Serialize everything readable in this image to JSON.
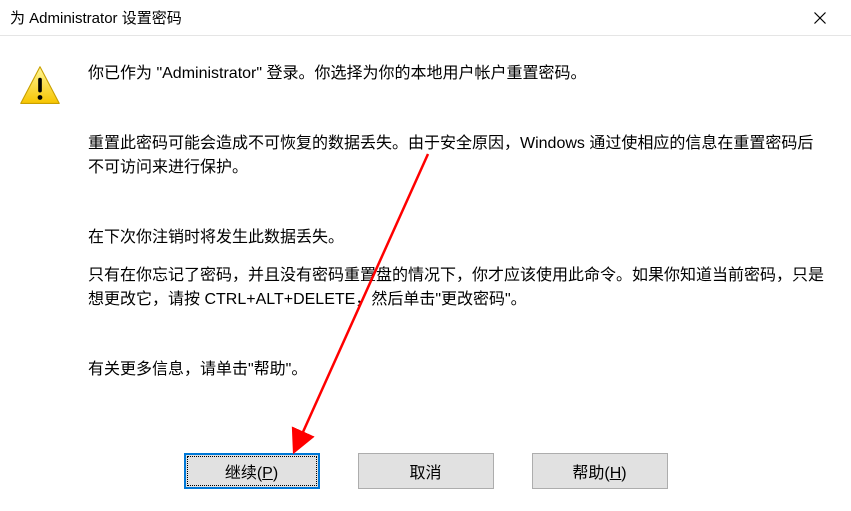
{
  "titlebar": {
    "title": "为 Administrator 设置密码"
  },
  "body": {
    "p1": "你已作为 \"Administrator\" 登录。你选择为你的本地用户帐户重置密码。",
    "p2": "重置此密码可能会造成不可恢复的数据丢失。由于安全原因，Windows 通过使相应的信息在重置密码后不可访问来进行保护。",
    "p3": "在下次你注销时将发生此数据丢失。",
    "p4": "只有在你忘记了密码，并且没有密码重置盘的情况下，你才应该使用此命令。如果你知道当前密码，只是想更改它，请按 CTRL+ALT+DELETE，然后单击\"更改密码\"。",
    "p5": "有关更多信息，请单击\"帮助\"。"
  },
  "buttons": {
    "continue_prefix": "继续(",
    "continue_mnemonic": "P",
    "continue_suffix": ")",
    "cancel": "取消",
    "help_prefix": "帮助(",
    "help_mnemonic": "H",
    "help_suffix": ")"
  },
  "icons": {
    "warning": "warning-icon",
    "close": "close-icon"
  },
  "annotation": {
    "arrow_color": "#ff0000"
  }
}
